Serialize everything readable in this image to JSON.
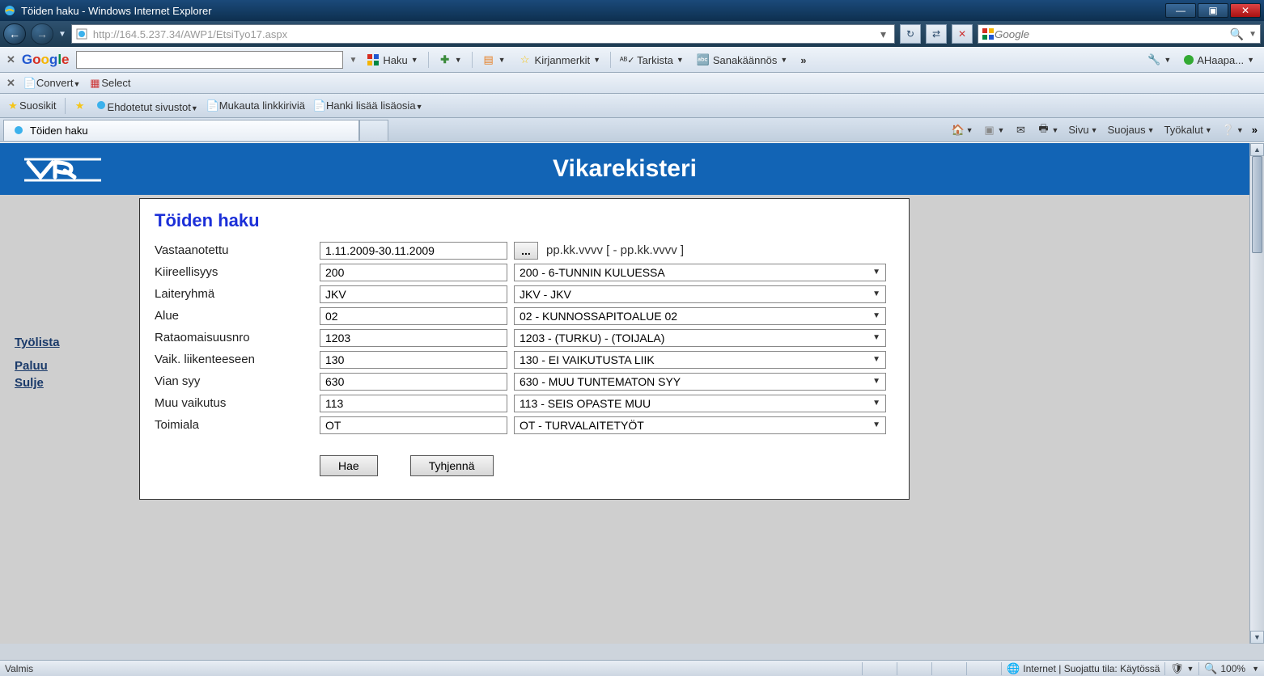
{
  "window": {
    "title": "Töiden haku - Windows Internet Explorer"
  },
  "nav": {
    "url": "http://164.5.237.34/AWP1/EtsiTyo17.aspx",
    "search_placeholder": "Google"
  },
  "gtoolbar": {
    "logo_colors": [
      [
        "G",
        "#2158d0"
      ],
      [
        "o",
        "#d62d20"
      ],
      [
        "o",
        "#f5b400"
      ],
      [
        "g",
        "#2158d0"
      ],
      [
        "l",
        "#008744"
      ],
      [
        "e",
        "#d62d20"
      ]
    ],
    "haku": "Haku",
    "kirjan": "Kirjanmerkit",
    "tarkista": "Tarkista",
    "sanak": "Sanakäännös",
    "user": "AHaapa..."
  },
  "convertbar": {
    "convert": "Convert",
    "select": "Select"
  },
  "favbar": {
    "suosikit": "Suosikit",
    "ehdotetut": "Ehdotetut sivustot",
    "mukauta": "Mukauta linkkiriviä",
    "hanki": "Hanki lisää lisäosia"
  },
  "tabs": {
    "active": "Töiden haku"
  },
  "commandbar": {
    "sivu": "Sivu",
    "suojaus": "Suojaus",
    "tyokalut": "Työkalut"
  },
  "header": {
    "logo": "VR",
    "title": "Vikarekisteri"
  },
  "sidebar": {
    "tyolista": "Työlista",
    "paluu": "Paluu",
    "sulje": "Sulje"
  },
  "form": {
    "title": "Töiden haku",
    "rows": [
      {
        "label": "Vastaanotettu",
        "val": "1.11.2009-30.11.2009",
        "hint": "pp.kk.vvvv [ - pp.kk.vvvv ]",
        "date": true
      },
      {
        "label": "Kiireellisyys",
        "val": "200",
        "desc": "200 - 6-TUNNIN KULUESSA"
      },
      {
        "label": "Laiteryhmä",
        "val": "JKV",
        "desc": "JKV - JKV"
      },
      {
        "label": "Alue",
        "val": "02",
        "desc": "02 - KUNNOSSAPITOALUE 02"
      },
      {
        "label": "Rataomaisuusnro",
        "val": "1203",
        "desc": "1203 - (TURKU) - (TOIJALA)"
      },
      {
        "label": "Vaik. liikenteeseen",
        "val": "130",
        "desc": "130 - EI VAIKUTUSTA LIIK"
      },
      {
        "label": "Vian syy",
        "val": "630",
        "desc": "630 - MUU TUNTEMATON SYY"
      },
      {
        "label": "Muu vaikutus",
        "val": "113",
        "desc": "113 - SEIS OPASTE MUU"
      },
      {
        "label": "Toimiala",
        "val": "OT",
        "desc": "OT - TURVALAITETYÖT"
      }
    ],
    "hae": "Hae",
    "tyhjenna": "Tyhjennä"
  },
  "status": {
    "valmis": "Valmis",
    "zone": "Internet | Suojattu tila: Käytössä",
    "zoom": "100%"
  }
}
